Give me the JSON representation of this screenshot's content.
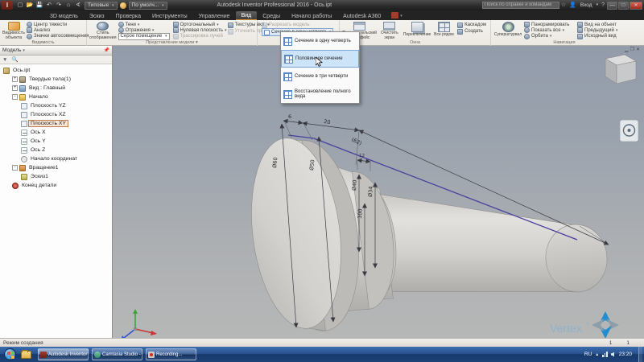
{
  "titlebar": {
    "logo_letter": "I",
    "qat_icons": [
      "new-icon",
      "open-icon",
      "save-icon",
      "undo-icon",
      "redo-icon",
      "home-icon",
      "measure-icon"
    ],
    "material_combo": "Типовые",
    "appearance_combo": "По умолч...",
    "app_title": "Autodesk Inventor Professional 2016 - Ось.ipt",
    "search_placeholder": "Поиск по справке и командам",
    "sign_in": "Вход"
  },
  "tabs": {
    "items": [
      "3D модель",
      "Эскиз",
      "Проверка",
      "Инструменты",
      "Управление",
      "Вид",
      "Среды",
      "Начало работы",
      "Autodesk A360"
    ],
    "active": "Вид"
  },
  "ribbon": {
    "visibility": {
      "label": "Видимость",
      "big": "Видимость объекта",
      "items": [
        "Центр тяжести",
        "Анализ",
        "Значки автосовмещения"
      ]
    },
    "appearance": {
      "label": "Представление модели ▾",
      "big": "Стиль отображения",
      "col1": [
        "Тени",
        "Отражения"
      ],
      "combo": "Серое помещение",
      "col2": [
        "Ортогональный",
        "Нулевая плоскость",
        "Трассировка лучей"
      ],
      "col3": [
        "Текстуры вкл.",
        "Уточнить представление"
      ]
    },
    "section": {
      "slice": "Разрезать модель",
      "quarter": "Сечение в одну четверть"
    },
    "windows": {
      "label": "Окна",
      "big": [
        "Пользовательский интерфейс",
        "Очистить экран",
        "Переключение",
        "Все рядом"
      ],
      "small": [
        "Каскадом",
        "Создать"
      ]
    },
    "navigation": {
      "label": "Навигация",
      "big": "Суперштурвал",
      "col1": [
        "Панорамировать",
        "Показать все",
        "Орбита"
      ],
      "col2": [
        "Вид на объект",
        "Предыдущий",
        "Исходный вид"
      ]
    }
  },
  "section_menu": {
    "items": [
      {
        "label": "Сечение в одну четверть",
        "active": false
      },
      {
        "label": "Половинное сечение",
        "active": true
      },
      {
        "label": "Сечение в три четверти",
        "active": false
      },
      {
        "label": "Восстановление полного вида",
        "active": false
      }
    ]
  },
  "browser": {
    "title": "Модель",
    "tree": [
      {
        "label": "Ось.ipt",
        "level": 0,
        "icon": "part",
        "expander": null,
        "selected": false
      },
      {
        "label": "Твердые тела(1)",
        "level": 1,
        "icon": "solids",
        "expander": "+",
        "selected": false
      },
      {
        "label": "Вид : Главный",
        "level": 1,
        "icon": "view",
        "expander": "+",
        "selected": false
      },
      {
        "label": "Начало",
        "level": 1,
        "icon": "folder",
        "expander": "-",
        "selected": false
      },
      {
        "label": "Плоскость YZ",
        "level": 2,
        "icon": "plane",
        "expander": null,
        "selected": false
      },
      {
        "label": "Плоскость XZ",
        "level": 2,
        "icon": "plane",
        "expander": null,
        "selected": false
      },
      {
        "label": "Плоскость XY",
        "level": 2,
        "icon": "plane",
        "expander": null,
        "selected": true
      },
      {
        "label": "Ось X",
        "level": 2,
        "icon": "axis",
        "expander": null,
        "selected": false
      },
      {
        "label": "Ось Y",
        "level": 2,
        "icon": "axis",
        "expander": null,
        "selected": false
      },
      {
        "label": "Ось Z",
        "level": 2,
        "icon": "axis",
        "expander": null,
        "selected": false
      },
      {
        "label": "Начало координат",
        "level": 2,
        "icon": "origin",
        "expander": null,
        "selected": false
      },
      {
        "label": "Вращение1",
        "level": 1,
        "icon": "revolve",
        "expander": "-",
        "selected": false
      },
      {
        "label": "Эскиз1",
        "level": 2,
        "icon": "sketch",
        "expander": null,
        "selected": false
      },
      {
        "label": "Конец детали",
        "level": 1,
        "icon": "eop",
        "expander": null,
        "selected": false
      }
    ]
  },
  "viewport": {
    "dims": {
      "d6": "6",
      "d20": "20",
      "d62": "(62)",
      "d60": "Ø60",
      "d50": "Ø50",
      "d40": "Ø40",
      "d34": "Ø34",
      "d12": "12",
      "d100": "100"
    },
    "logo_text": "Vertex"
  },
  "statusbar": {
    "mode": "Режим создания",
    "count1": "1",
    "count2": "1"
  },
  "taskbar": {
    "buttons": [
      {
        "label": "Autodesk Inventor Pr...",
        "icon": "inventor",
        "active": true
      },
      {
        "label": "Camtasia Studio - Se...",
        "icon": "camtasia",
        "active": false
      },
      {
        "label": "Recording...",
        "icon": "recording",
        "active": false
      }
    ],
    "tray": {
      "lang": "RU",
      "time": "23:20"
    }
  }
}
